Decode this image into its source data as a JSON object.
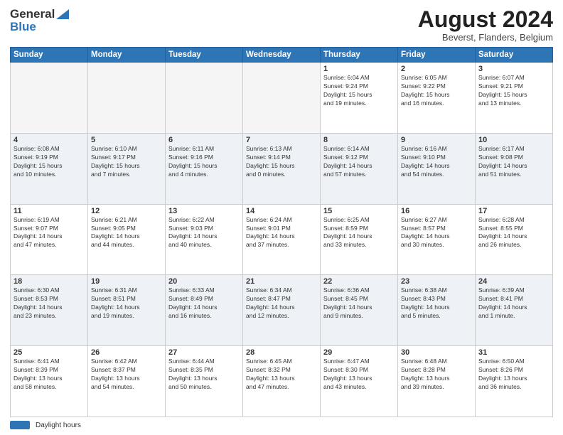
{
  "header": {
    "logo_line1": "General",
    "logo_line2": "Blue",
    "month_year": "August 2024",
    "location": "Beverst, Flanders, Belgium"
  },
  "days_of_week": [
    "Sunday",
    "Monday",
    "Tuesday",
    "Wednesday",
    "Thursday",
    "Friday",
    "Saturday"
  ],
  "weeks": [
    {
      "row_class": "row-white",
      "days": [
        {
          "num": "",
          "info": "",
          "empty": true
        },
        {
          "num": "",
          "info": "",
          "empty": true
        },
        {
          "num": "",
          "info": "",
          "empty": true
        },
        {
          "num": "",
          "info": "",
          "empty": true
        },
        {
          "num": "1",
          "info": "Sunrise: 6:04 AM\nSunset: 9:24 PM\nDaylight: 15 hours\nand 19 minutes.",
          "empty": false
        },
        {
          "num": "2",
          "info": "Sunrise: 6:05 AM\nSunset: 9:22 PM\nDaylight: 15 hours\nand 16 minutes.",
          "empty": false
        },
        {
          "num": "3",
          "info": "Sunrise: 6:07 AM\nSunset: 9:21 PM\nDaylight: 15 hours\nand 13 minutes.",
          "empty": false
        }
      ]
    },
    {
      "row_class": "row-light",
      "days": [
        {
          "num": "4",
          "info": "Sunrise: 6:08 AM\nSunset: 9:19 PM\nDaylight: 15 hours\nand 10 minutes.",
          "empty": false
        },
        {
          "num": "5",
          "info": "Sunrise: 6:10 AM\nSunset: 9:17 PM\nDaylight: 15 hours\nand 7 minutes.",
          "empty": false
        },
        {
          "num": "6",
          "info": "Sunrise: 6:11 AM\nSunset: 9:16 PM\nDaylight: 15 hours\nand 4 minutes.",
          "empty": false
        },
        {
          "num": "7",
          "info": "Sunrise: 6:13 AM\nSunset: 9:14 PM\nDaylight: 15 hours\nand 0 minutes.",
          "empty": false
        },
        {
          "num": "8",
          "info": "Sunrise: 6:14 AM\nSunset: 9:12 PM\nDaylight: 14 hours\nand 57 minutes.",
          "empty": false
        },
        {
          "num": "9",
          "info": "Sunrise: 6:16 AM\nSunset: 9:10 PM\nDaylight: 14 hours\nand 54 minutes.",
          "empty": false
        },
        {
          "num": "10",
          "info": "Sunrise: 6:17 AM\nSunset: 9:08 PM\nDaylight: 14 hours\nand 51 minutes.",
          "empty": false
        }
      ]
    },
    {
      "row_class": "row-white",
      "days": [
        {
          "num": "11",
          "info": "Sunrise: 6:19 AM\nSunset: 9:07 PM\nDaylight: 14 hours\nand 47 minutes.",
          "empty": false
        },
        {
          "num": "12",
          "info": "Sunrise: 6:21 AM\nSunset: 9:05 PM\nDaylight: 14 hours\nand 44 minutes.",
          "empty": false
        },
        {
          "num": "13",
          "info": "Sunrise: 6:22 AM\nSunset: 9:03 PM\nDaylight: 14 hours\nand 40 minutes.",
          "empty": false
        },
        {
          "num": "14",
          "info": "Sunrise: 6:24 AM\nSunset: 9:01 PM\nDaylight: 14 hours\nand 37 minutes.",
          "empty": false
        },
        {
          "num": "15",
          "info": "Sunrise: 6:25 AM\nSunset: 8:59 PM\nDaylight: 14 hours\nand 33 minutes.",
          "empty": false
        },
        {
          "num": "16",
          "info": "Sunrise: 6:27 AM\nSunset: 8:57 PM\nDaylight: 14 hours\nand 30 minutes.",
          "empty": false
        },
        {
          "num": "17",
          "info": "Sunrise: 6:28 AM\nSunset: 8:55 PM\nDaylight: 14 hours\nand 26 minutes.",
          "empty": false
        }
      ]
    },
    {
      "row_class": "row-light",
      "days": [
        {
          "num": "18",
          "info": "Sunrise: 6:30 AM\nSunset: 8:53 PM\nDaylight: 14 hours\nand 23 minutes.",
          "empty": false
        },
        {
          "num": "19",
          "info": "Sunrise: 6:31 AM\nSunset: 8:51 PM\nDaylight: 14 hours\nand 19 minutes.",
          "empty": false
        },
        {
          "num": "20",
          "info": "Sunrise: 6:33 AM\nSunset: 8:49 PM\nDaylight: 14 hours\nand 16 minutes.",
          "empty": false
        },
        {
          "num": "21",
          "info": "Sunrise: 6:34 AM\nSunset: 8:47 PM\nDaylight: 14 hours\nand 12 minutes.",
          "empty": false
        },
        {
          "num": "22",
          "info": "Sunrise: 6:36 AM\nSunset: 8:45 PM\nDaylight: 14 hours\nand 9 minutes.",
          "empty": false
        },
        {
          "num": "23",
          "info": "Sunrise: 6:38 AM\nSunset: 8:43 PM\nDaylight: 14 hours\nand 5 minutes.",
          "empty": false
        },
        {
          "num": "24",
          "info": "Sunrise: 6:39 AM\nSunset: 8:41 PM\nDaylight: 14 hours\nand 1 minute.",
          "empty": false
        }
      ]
    },
    {
      "row_class": "row-white",
      "days": [
        {
          "num": "25",
          "info": "Sunrise: 6:41 AM\nSunset: 8:39 PM\nDaylight: 13 hours\nand 58 minutes.",
          "empty": false
        },
        {
          "num": "26",
          "info": "Sunrise: 6:42 AM\nSunset: 8:37 PM\nDaylight: 13 hours\nand 54 minutes.",
          "empty": false
        },
        {
          "num": "27",
          "info": "Sunrise: 6:44 AM\nSunset: 8:35 PM\nDaylight: 13 hours\nand 50 minutes.",
          "empty": false
        },
        {
          "num": "28",
          "info": "Sunrise: 6:45 AM\nSunset: 8:32 PM\nDaylight: 13 hours\nand 47 minutes.",
          "empty": false
        },
        {
          "num": "29",
          "info": "Sunrise: 6:47 AM\nSunset: 8:30 PM\nDaylight: 13 hours\nand 43 minutes.",
          "empty": false
        },
        {
          "num": "30",
          "info": "Sunrise: 6:48 AM\nSunset: 8:28 PM\nDaylight: 13 hours\nand 39 minutes.",
          "empty": false
        },
        {
          "num": "31",
          "info": "Sunrise: 6:50 AM\nSunset: 8:26 PM\nDaylight: 13 hours\nand 36 minutes.",
          "empty": false
        }
      ]
    }
  ],
  "footer": {
    "legend_label": "Daylight hours"
  }
}
